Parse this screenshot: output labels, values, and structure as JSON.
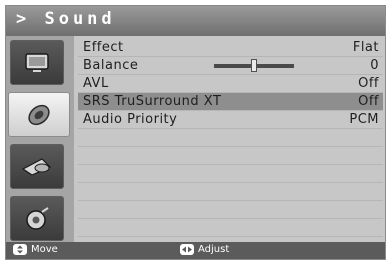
{
  "title": "> Sound",
  "menu": [
    {
      "label": "Effect",
      "value": "Flat"
    },
    {
      "label": "Balance",
      "value": "0",
      "slider_level": 0.5
    },
    {
      "label": "AVL",
      "value": "Off"
    },
    {
      "label": "SRS TruSurround XT",
      "value": "Off",
      "selected": true
    },
    {
      "label": "Audio Priority",
      "value": "PCM"
    }
  ],
  "sidebar": [
    {
      "icon": "picture-icon"
    },
    {
      "icon": "sound-icon",
      "active": true
    },
    {
      "icon": "channel-icon"
    },
    {
      "icon": "setup-icon"
    }
  ],
  "footer": {
    "move_label": "Move",
    "adjust_label": "Adjust"
  }
}
